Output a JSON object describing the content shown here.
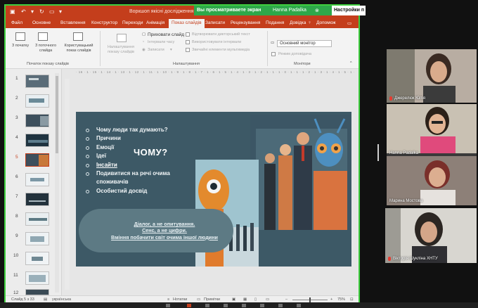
{
  "window": {
    "doc_title": "Воркшоп якісні дослідження 16",
    "share_banner": {
      "text": "Вы просматриваете экран",
      "presenter": "Hanna Padalka"
    },
    "settings_tab": "Настройки п"
  },
  "tabs": [
    {
      "label": "Файл"
    },
    {
      "label": "Основне"
    },
    {
      "label": "Вставлення"
    },
    {
      "label": "Конструктор"
    },
    {
      "label": "Переходи"
    },
    {
      "label": "Анімація"
    },
    {
      "label": "Показ слайдів",
      "active": true
    },
    {
      "label": "Записати"
    },
    {
      "label": "Рецензування"
    },
    {
      "label": "Подання"
    },
    {
      "label": "Довідка"
    },
    {
      "label": "Допомож"
    }
  ],
  "ribbon": {
    "btn_from_start": "З початку",
    "btn_from_current": "З поточного слайда",
    "btn_custom": "Користувацький показ слайдів",
    "group_start": "Початок показу слайдів",
    "btn_setup": "Налаштування показу слайдів",
    "btn_hide": "Приховати слайд",
    "btn_rehearse": "Інтервали часу",
    "btn_record": "Записати",
    "chk_captions": "Відтворювати дикторський текст",
    "chk_timings": "Використовувати інтервали",
    "chk_media": "Звичайні елементи мультимедіа",
    "group_setup": "Налаштування",
    "monitor_select": "Основний монітор",
    "chk_presenter": "Режим доповідача",
    "group_monitors": "Монітори"
  },
  "thumbnails": [
    {
      "num": "1"
    },
    {
      "num": "2"
    },
    {
      "num": "3"
    },
    {
      "num": "4"
    },
    {
      "num": "5",
      "selected": true
    },
    {
      "num": "6"
    },
    {
      "num": "7"
    },
    {
      "num": "8"
    },
    {
      "num": "9"
    },
    {
      "num": "10"
    },
    {
      "num": "11"
    },
    {
      "num": "12"
    }
  ],
  "ruler": "· 16 · 1 · 15 · 1 · 14 · 1 · 13 · 1 · 12 · 1 · 11 · 1 · 10 · 1 · 9 · 1 · 8 · 1 · 7 · 1 · 6 · 1 · 5 · 1 · 4 · 1 · 3 · 1 · 2 · 1 · 1 · 1 · 0 · 1 · 1 · 1 · 2 · 1 · 3 · 1 · 4 · 1 · 5 · 1 · 6 · 1 · 7 · 1 · 8 · 1 · 9 · 1 · 10 · 1 · 11 · 1 · 12 · 1 · 13 · 1 · 14 · 1 · 15 · 1 · 16 ·",
  "slide": {
    "bullets": [
      "Чому люди так думають?",
      "Причини",
      "Емоції",
      "Ідеї",
      "Інсайти",
      "Подивитися на речі очима споживачів",
      "Особистий досвід"
    ],
    "heading": "ЧОМУ?",
    "quote_lines": [
      "Діалог, а не опитування.",
      "Сенс, а не цифри.",
      "Вміння побачити світ очима іншої людини"
    ]
  },
  "status": {
    "slide_info": "Слайд 5 з 33",
    "language": "українська",
    "notes": "Нотатки",
    "comments": "Примітки",
    "zoom": "75%"
  },
  "participants": [
    {
      "name": "Джерелюк Юлія"
    },
    {
      "name": "Hanna Padalka"
    },
    {
      "name": "Марина Мостова"
    },
    {
      "name": "Вікторія Шукліна ХНТУ"
    }
  ],
  "colors": {
    "ppt_accent": "#c43e1c",
    "share_green": "#2ea84a",
    "slide_bg": "#3d5966"
  }
}
